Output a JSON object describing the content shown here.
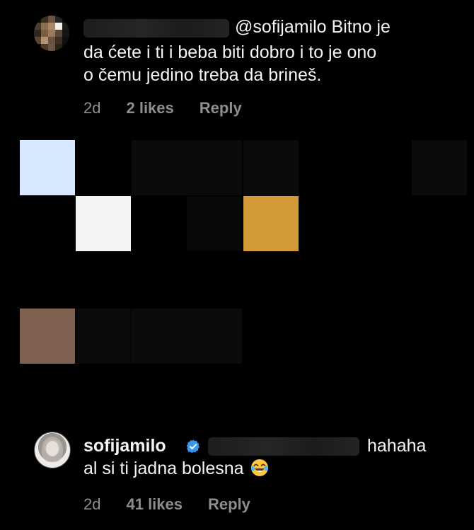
{
  "comments": [
    {
      "mention": "@sofijamilo",
      "text_line1": "Bitno je",
      "text_line2": "da ćete i ti i beba biti dobro i to je ono",
      "text_line3": "o čemu jedino treba da brineš.",
      "time": "2d",
      "likes": "2 likes",
      "reply": "Reply"
    },
    {
      "username": "sofijamilo",
      "text_tail": "hahaha",
      "text_line2": "al si ti jadna bolesna",
      "emoji": "face-with-tears-of-joy-icon",
      "time": "2d",
      "likes": "41 likes",
      "reply": "Reply"
    }
  ],
  "colors": {
    "background": "#000000",
    "text": "#f5f5f5",
    "meta": "#8e8e8e",
    "verified": "#3797f0"
  }
}
